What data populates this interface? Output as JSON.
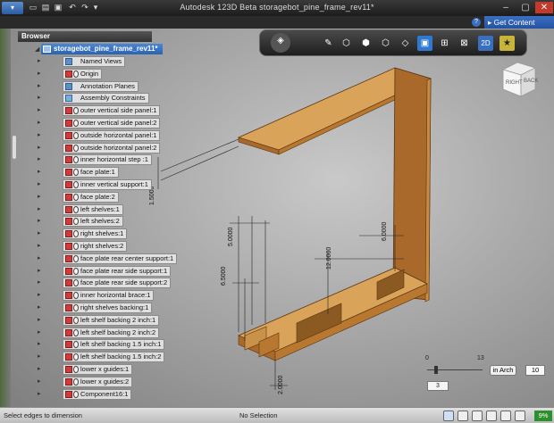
{
  "window": {
    "title": "Autodesk 123D Beta   storagebot_pine_frame_rev11*",
    "get_content": "Get Content"
  },
  "browser": {
    "header": "Browser",
    "root": "storagebot_pine_frame_rev11*",
    "items": [
      {
        "label": "Named Views",
        "kind": "folder"
      },
      {
        "label": "Origin",
        "kind": "body"
      },
      {
        "label": "Annotation Planes",
        "kind": "folder"
      },
      {
        "label": "Assembly Constraints",
        "kind": "constraint"
      },
      {
        "label": "outer vertical side panel:1",
        "kind": "body"
      },
      {
        "label": "outer vertical side panel:2",
        "kind": "body"
      },
      {
        "label": "outside horizontal panel:1",
        "kind": "body"
      },
      {
        "label": "outside horizontal panel:2",
        "kind": "body"
      },
      {
        "label": "inner horizontal step :1",
        "kind": "body"
      },
      {
        "label": "face plate:1",
        "kind": "body"
      },
      {
        "label": "inner vertical support:1",
        "kind": "body"
      },
      {
        "label": "face plate:2",
        "kind": "body"
      },
      {
        "label": "left shelves:1",
        "kind": "body"
      },
      {
        "label": "left shelves:2",
        "kind": "body"
      },
      {
        "label": "right shelves:1",
        "kind": "body"
      },
      {
        "label": "right shelves:2",
        "kind": "body"
      },
      {
        "label": "face plate rear center support:1",
        "kind": "body"
      },
      {
        "label": "face plate rear side support:1",
        "kind": "body"
      },
      {
        "label": "face plate rear side support:2",
        "kind": "body"
      },
      {
        "label": "inner horizontal brace:1",
        "kind": "body"
      },
      {
        "label": "right shelves backing:1",
        "kind": "body"
      },
      {
        "label": "left shelf backing 2 inch:1",
        "kind": "body"
      },
      {
        "label": "left shelf backing 2 inch:2",
        "kind": "body"
      },
      {
        "label": "left shelf backing 1.5 inch:1",
        "kind": "body"
      },
      {
        "label": "left shelf backing 1.5 inch:2",
        "kind": "body"
      },
      {
        "label": "lower x guides:1",
        "kind": "body"
      },
      {
        "label": "lower x guides:2",
        "kind": "body"
      },
      {
        "label": "Component16:1",
        "kind": "body"
      }
    ]
  },
  "viewport": {
    "dimensions": {
      "d1": "1.5000",
      "d2": "5.0000",
      "d3": "6.0000",
      "d4": "12.0000",
      "d5": "6.5000",
      "d6": "2.0000"
    },
    "viewcube": {
      "right": "RIGHT",
      "back": "BACK"
    }
  },
  "scale": {
    "min": "0",
    "max": "13",
    "unit": "in Arch",
    "value": "10",
    "step": "3"
  },
  "status": {
    "hint": "Select edges to dimension",
    "selection": "No Selection",
    "percent": "9%"
  },
  "colors": {
    "wood_top": "#d9a35a",
    "wood_side": "#a8692a",
    "wood_dark": "#7a4a18",
    "accent": "#2a62b0"
  }
}
